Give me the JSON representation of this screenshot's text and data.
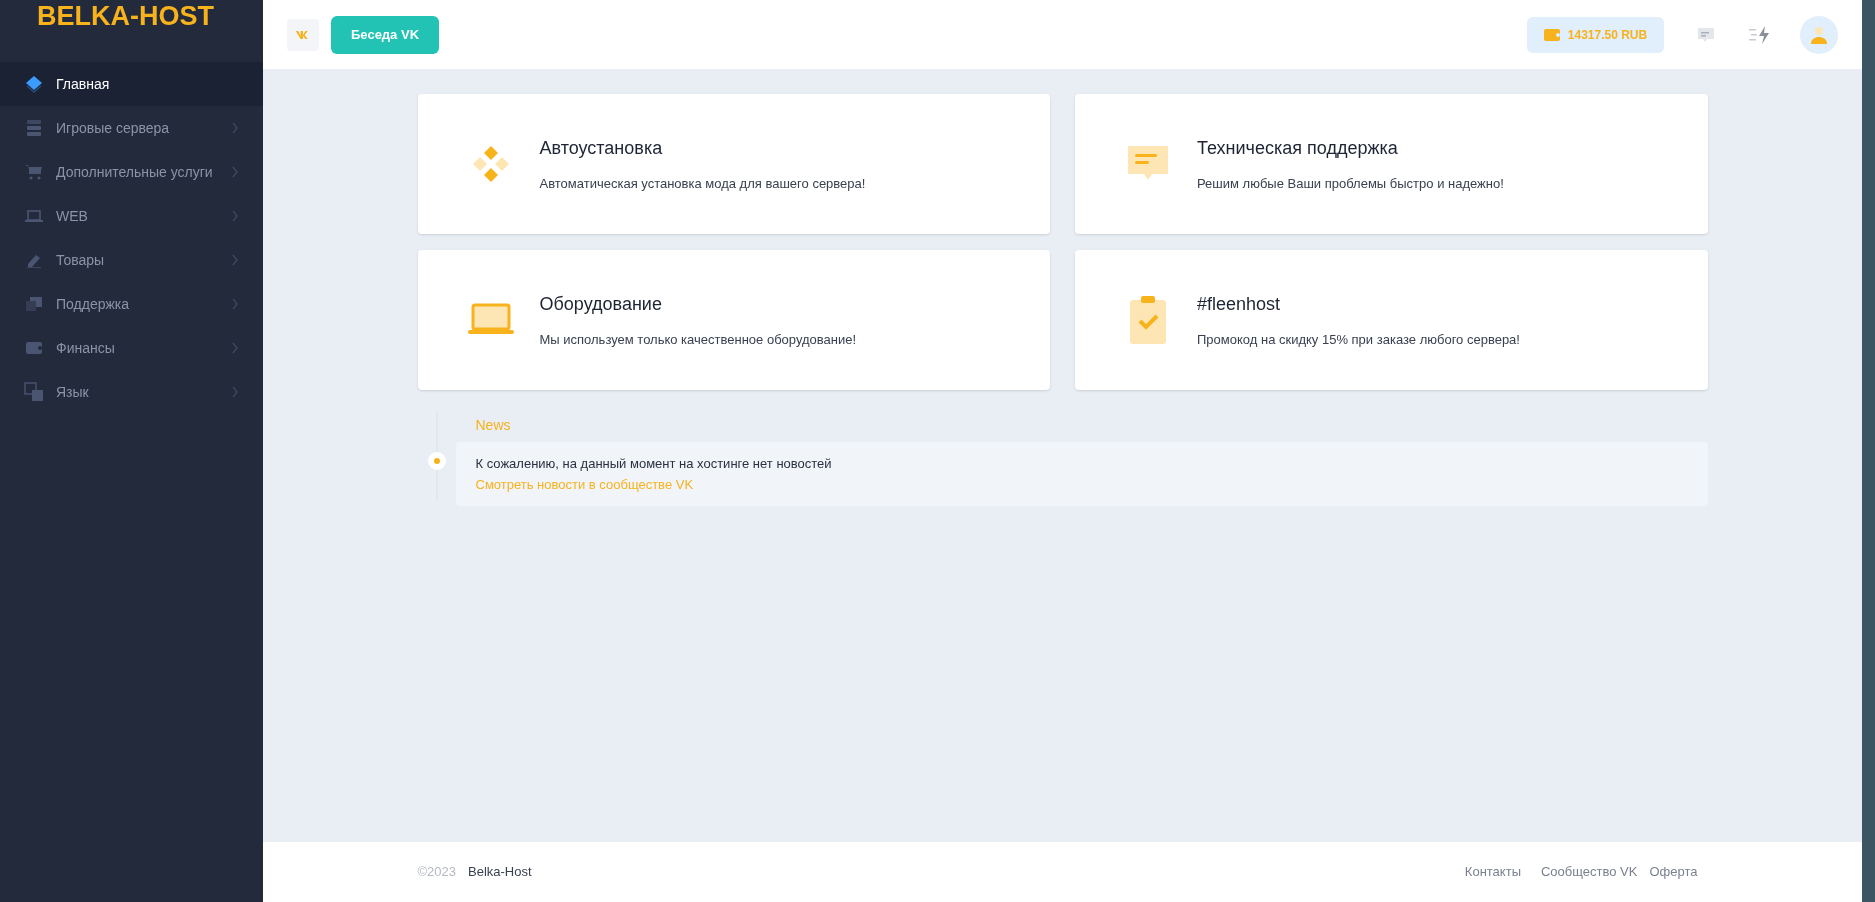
{
  "sidebar": {
    "logo": "BELKA-HOST",
    "items": [
      {
        "label": "Главная",
        "selected": true,
        "has_submenu": false
      },
      {
        "label": "Игровые сервера",
        "selected": false,
        "has_submenu": true
      },
      {
        "label": "Дополнительные услуги",
        "selected": false,
        "has_submenu": true
      },
      {
        "label": "WEB",
        "selected": false,
        "has_submenu": true
      },
      {
        "label": "Товары",
        "selected": false,
        "has_submenu": true
      },
      {
        "label": "Поддержка",
        "selected": false,
        "has_submenu": true
      },
      {
        "label": "Финансы",
        "selected": false,
        "has_submenu": true
      },
      {
        "label": "Язык",
        "selected": false,
        "has_submenu": true
      }
    ]
  },
  "header": {
    "chat_button": "Беседа VK",
    "balance": "14317.50 RUB"
  },
  "cards": [
    {
      "title": "Автоустановка",
      "text": "Автоматическая установка мода для вашего сервера!"
    },
    {
      "title": "Техническая поддержка",
      "text": "Решим любые Ваши проблемы быстро и надежно!"
    },
    {
      "title": "Оборудование",
      "text": "Мы используем только качественное оборудование!"
    },
    {
      "title": "#fleenhost",
      "text": "Промокод на скидку 15% при заказе любого сервера!"
    }
  ],
  "news": {
    "title": "News",
    "message": "К сожалению, на данный момент на хостинге нет новостей",
    "link": "Смотреть новости в сообществе VK"
  },
  "footer": {
    "year": "©2023",
    "brand": "Belka-Host",
    "links": [
      "Контакты",
      "Сообщество VK",
      "Оферта"
    ]
  }
}
